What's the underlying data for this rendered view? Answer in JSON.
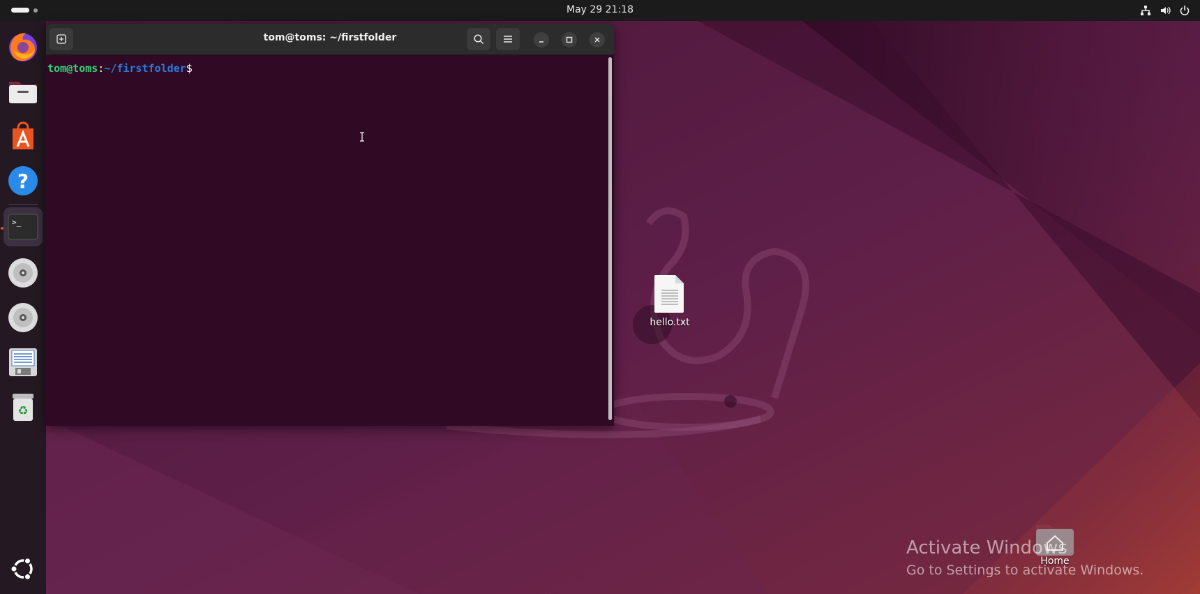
{
  "topbar": {
    "clock": "May 29  21:18",
    "icons": [
      "network-icon",
      "volume-icon",
      "power-icon"
    ]
  },
  "dock": {
    "items": [
      {
        "name": "firefox",
        "icon": "firefox-icon"
      },
      {
        "name": "files",
        "icon": "files-icon"
      },
      {
        "name": "app-center",
        "icon": "app-center-icon"
      },
      {
        "name": "help",
        "icon": "help-icon"
      },
      {
        "name": "terminal",
        "icon": "terminal-icon",
        "active": true
      },
      {
        "name": "disc-1",
        "icon": "disc-icon"
      },
      {
        "name": "disc-2",
        "icon": "disc-icon"
      },
      {
        "name": "save-disk",
        "icon": "floppy-icon"
      },
      {
        "name": "trash",
        "icon": "trash-icon"
      }
    ],
    "show_apps": "ubuntu-logo-icon"
  },
  "terminal": {
    "title": "tom@toms: ~/firstfolder",
    "prompt": {
      "user": "tom@toms",
      "colon": ":",
      "path": "~/firstfolder",
      "dollar": "$"
    }
  },
  "desktop": {
    "icons": [
      {
        "label": "hello.txt",
        "icon": "text-file-icon"
      },
      {
        "label": "Home",
        "icon": "home-folder-icon"
      }
    ]
  },
  "watermark": {
    "line1": "Activate Windows",
    "line2": "Go to Settings to activate Windows."
  },
  "colors": {
    "terminal_bg": "#300a24",
    "prompt_user": "#33d17a",
    "prompt_path": "#2a7bde",
    "accent": "#e95420"
  }
}
